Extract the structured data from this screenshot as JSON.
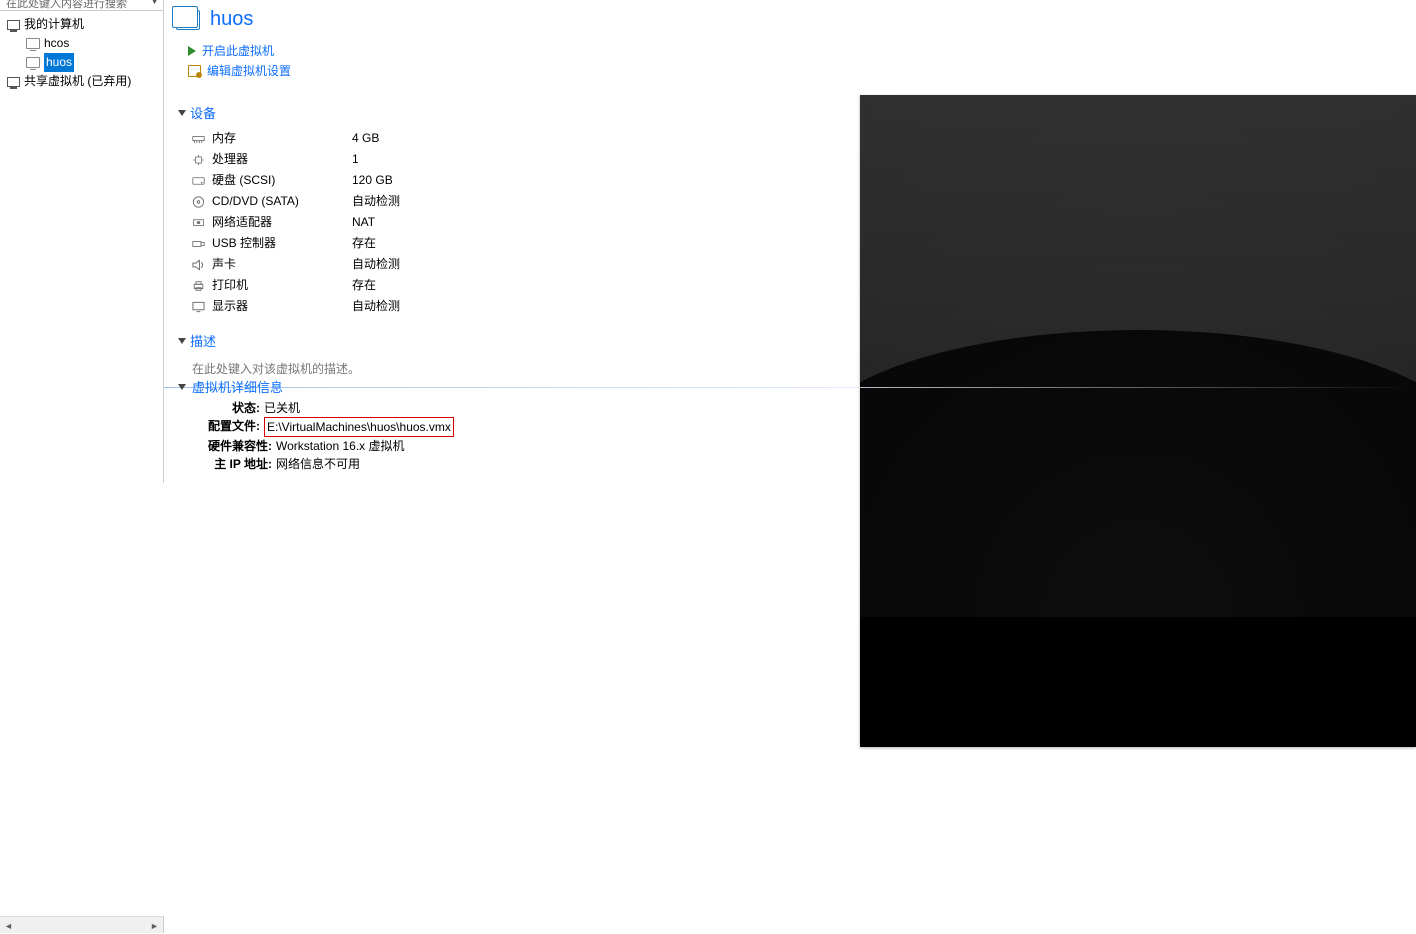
{
  "sidebar": {
    "search_placeholder": "在此处键入内容进行搜索",
    "my_computer": "我的计算机",
    "vms": [
      {
        "name": "hcos"
      },
      {
        "name": "huos"
      }
    ],
    "shared": "共享虚拟机 (已弃用)"
  },
  "vm": {
    "title": "huos",
    "actions": {
      "power_on": "开启此虚拟机",
      "edit_settings": "编辑虚拟机设置"
    }
  },
  "sections": {
    "devices": "设备",
    "description": "描述",
    "details": "虚拟机详细信息"
  },
  "devices": [
    {
      "icon": "memory",
      "name": "内存",
      "value": "4 GB"
    },
    {
      "icon": "cpu",
      "name": "处理器",
      "value": "1"
    },
    {
      "icon": "disk",
      "name": "硬盘 (SCSI)",
      "value": "120 GB"
    },
    {
      "icon": "disc",
      "name": "CD/DVD (SATA)",
      "value": "自动检测"
    },
    {
      "icon": "net",
      "name": "网络适配器",
      "value": "NAT"
    },
    {
      "icon": "usb",
      "name": "USB 控制器",
      "value": "存在"
    },
    {
      "icon": "sound",
      "name": "声卡",
      "value": "自动检测"
    },
    {
      "icon": "printer",
      "name": "打印机",
      "value": "存在"
    },
    {
      "icon": "display",
      "name": "显示器",
      "value": "自动检测"
    }
  ],
  "description_placeholder": "在此处键入对该虚拟机的描述。",
  "details": {
    "state_label": "状态:",
    "state_value": "已关机",
    "config_label": "配置文件:",
    "config_value": "E:\\VirtualMachines\\huos\\huos.vmx",
    "hw_label": "硬件兼容性:",
    "hw_value": "Workstation 16.x 虚拟机",
    "ip_label": "主 IP 地址:",
    "ip_value": "网络信息不可用"
  }
}
